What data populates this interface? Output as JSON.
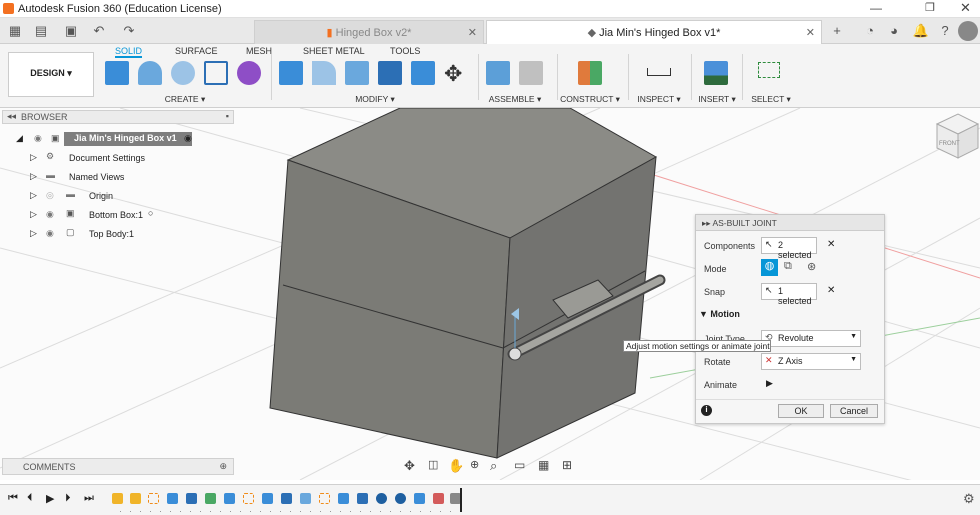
{
  "window": {
    "title": "Autodesk Fusion 360 (Education License)"
  },
  "doc_tabs": [
    {
      "label": "Hinged Box v2*",
      "active": false
    },
    {
      "label": "Jia Min's Hinged Box v1*",
      "active": true
    }
  ],
  "ribbon": {
    "workspace": "DESIGN",
    "tabs": [
      "SOLID",
      "SURFACE",
      "MESH",
      "SHEET METAL",
      "TOOLS"
    ],
    "groups": [
      "CREATE",
      "MODIFY",
      "ASSEMBLE",
      "CONSTRUCT",
      "INSPECT",
      "INSERT",
      "SELECT"
    ]
  },
  "browser": {
    "title": "BROWSER",
    "root": "Jia Min's Hinged Box v1",
    "items": [
      "Document Settings",
      "Named Views",
      "Origin",
      "Bottom Box:1",
      "Top Body:1"
    ]
  },
  "comments": {
    "title": "COMMENTS"
  },
  "joint_panel": {
    "title": "AS-BUILT JOINT",
    "components_label": "Components",
    "components_value": "2 selected",
    "mode_label": "Mode",
    "snap_label": "Snap",
    "snap_value": "1 selected",
    "motion_section": "Motion",
    "joint_type_label": "Joint Type",
    "joint_type_value": "Revolute",
    "rotate_label": "Rotate",
    "rotate_value": "Z Axis",
    "animate_label": "Animate",
    "ok": "OK",
    "cancel": "Cancel"
  },
  "tooltip": "Adjust motion settings or animate joint",
  "viewcube": {
    "face": "FRONT"
  },
  "colors": {
    "accent": "#0696d7",
    "model": "#7d7d78",
    "model_top": "#8a8a85"
  }
}
